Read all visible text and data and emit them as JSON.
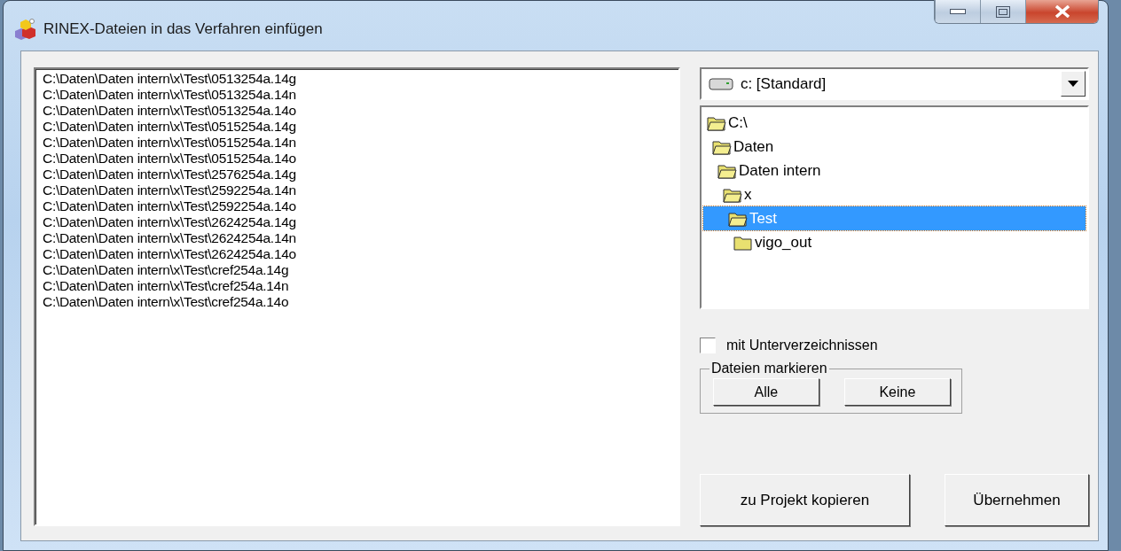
{
  "window": {
    "title": "RINEX-Dateien in das Verfahren einfügen"
  },
  "files": [
    "C:\\Daten\\Daten intern\\x\\Test\\0513254a.14g",
    "C:\\Daten\\Daten intern\\x\\Test\\0513254a.14n",
    "C:\\Daten\\Daten intern\\x\\Test\\0513254a.14o",
    "C:\\Daten\\Daten intern\\x\\Test\\0515254a.14g",
    "C:\\Daten\\Daten intern\\x\\Test\\0515254a.14n",
    "C:\\Daten\\Daten intern\\x\\Test\\0515254a.14o",
    "C:\\Daten\\Daten intern\\x\\Test\\2576254a.14g",
    "C:\\Daten\\Daten intern\\x\\Test\\2592254a.14n",
    "C:\\Daten\\Daten intern\\x\\Test\\2592254a.14o",
    "C:\\Daten\\Daten intern\\x\\Test\\2624254a.14g",
    "C:\\Daten\\Daten intern\\x\\Test\\2624254a.14n",
    "C:\\Daten\\Daten intern\\x\\Test\\2624254a.14o",
    "C:\\Daten\\Daten intern\\x\\Test\\cref254a.14g",
    "C:\\Daten\\Daten intern\\x\\Test\\cref254a.14n",
    "C:\\Daten\\Daten intern\\x\\Test\\cref254a.14o"
  ],
  "drive": {
    "value": "c: [Standard]"
  },
  "tree": [
    {
      "label": "C:\\",
      "expanded": true,
      "selected": false,
      "children": [
        {
          "label": "Daten",
          "expanded": true,
          "selected": false,
          "children": [
            {
              "label": "Daten intern",
              "expanded": true,
              "selected": false,
              "children": [
                {
                  "label": "x",
                  "expanded": true,
                  "selected": false,
                  "children": [
                    {
                      "label": "Test",
                      "expanded": true,
                      "selected": true,
                      "children": [
                        {
                          "label": "vigo_out",
                          "expanded": false,
                          "selected": false
                        }
                      ]
                    }
                  ]
                }
              ]
            }
          ]
        }
      ]
    }
  ],
  "subdirectories": {
    "label": "mit Unterverzeichnissen",
    "checked": false
  },
  "mark_group": {
    "title": "Dateien markieren",
    "buttons": [
      "Alle",
      "Keine"
    ]
  },
  "buttons": [
    "zu Projekt kopieren",
    "Übernehmen"
  ]
}
